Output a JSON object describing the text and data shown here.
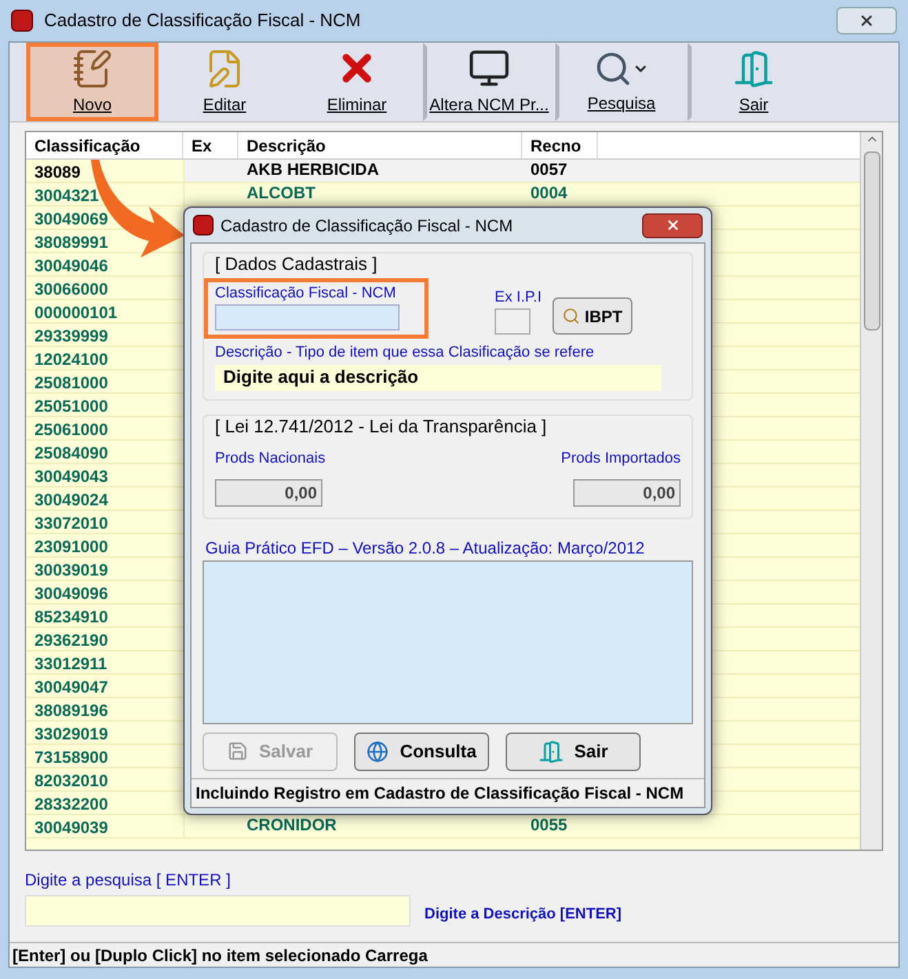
{
  "window": {
    "title": "Cadastro de Classificação Fiscal - NCM"
  },
  "toolbar": [
    {
      "label": "Novo",
      "kind": "notebook",
      "selected": true
    },
    {
      "label": "Editar",
      "kind": "edit",
      "selected": false
    },
    {
      "label": "Eliminar",
      "kind": "delete",
      "selected": false
    },
    {
      "label": "Altera NCM Pr...",
      "kind": "monitor",
      "selected": false
    },
    {
      "label": "Pesquisa",
      "kind": "search",
      "selected": false
    },
    {
      "label": "Sair",
      "kind": "exit",
      "selected": false
    }
  ],
  "table": {
    "columns": [
      "Classificação",
      "Ex",
      "Descrição",
      "Recno"
    ],
    "rows": [
      {
        "code": "38089",
        "description": "AKB HERBICIDA",
        "recno": "0057",
        "selected": true
      },
      {
        "code": "3004321",
        "description": "ALCOBT",
        "recno": "0004",
        "selected": false
      },
      {
        "code": "30049069",
        "selected": false
      },
      {
        "code": "38089991",
        "selected": false
      },
      {
        "code": "30049046",
        "selected": false
      },
      {
        "code": "30066000",
        "selected": false
      },
      {
        "code": "000000101",
        "selected": false
      },
      {
        "code": "29339999",
        "selected": false
      },
      {
        "code": "12024100",
        "selected": false
      },
      {
        "code": "25081000",
        "selected": false
      },
      {
        "code": "25051000",
        "selected": false
      },
      {
        "code": "25061000",
        "selected": false
      },
      {
        "code": "25084090",
        "selected": false
      },
      {
        "code": "30049043",
        "selected": false
      },
      {
        "code": "30049024",
        "selected": false
      },
      {
        "code": "33072010",
        "selected": false
      },
      {
        "code": "23091000",
        "selected": false
      },
      {
        "code": "30039019",
        "selected": false
      },
      {
        "code": "30049096",
        "selected": false
      },
      {
        "code": "85234910",
        "selected": false
      },
      {
        "code": "29362190",
        "selected": false
      },
      {
        "code": "33012911",
        "selected": false
      },
      {
        "code": "30049047",
        "selected": false
      },
      {
        "code": "38089196",
        "selected": false
      },
      {
        "code": "33029019",
        "selected": false
      },
      {
        "code": "73158900",
        "selected": false
      },
      {
        "code": "82032010",
        "selected": false
      },
      {
        "code": "28332200",
        "selected": false
      },
      {
        "code": "30049039",
        "description": "CRONIDOR",
        "recno": "0055",
        "selected": false
      }
    ]
  },
  "search": {
    "label": "Digite a pesquisa [ ENTER ]",
    "hint": "Digite a Descrição [ENTER]"
  },
  "status_bar": "[Enter] ou [Duplo Click] no item selecionado Carrega",
  "dialog": {
    "title": "Cadastro de Classificação Fiscal - NCM",
    "group1": {
      "title": "[ Dados Cadastrais ]",
      "ncm_label": "Classificação Fiscal - NCM",
      "ex_label": "Ex I.P.I",
      "ibpt_button": "IBPT",
      "desc_label": "Descrição - Tipo de item que essa Clasificação se refere",
      "desc_value": "Digite aqui a descrição"
    },
    "group2": {
      "title": "[ Lei 12.741/2012 - Lei da Transparência ]",
      "nac_label": "Prods Nacionais",
      "nac_value": "0,00",
      "imp_label": "Prods Importados",
      "imp_value": "0,00"
    },
    "guide_label": "Guia Prático EFD – Versão 2.0.8 – Atualização: Março/2012",
    "buttons": [
      {
        "label": "Salvar",
        "kind": "save",
        "disabled": true
      },
      {
        "label": "Consulta",
        "kind": "web",
        "disabled": false
      },
      {
        "label": "Sair",
        "kind": "exit",
        "disabled": false
      }
    ],
    "status": "Incluindo Registro em Cadastro de Classificação Fiscal - NCM"
  }
}
